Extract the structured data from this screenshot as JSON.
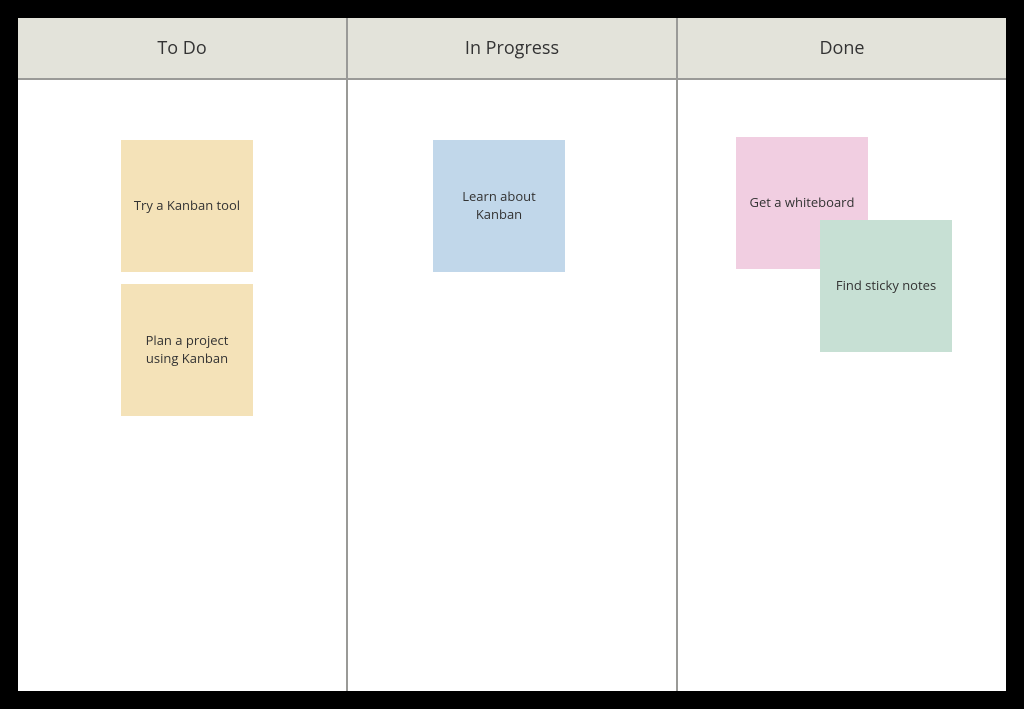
{
  "board": {
    "columns": [
      {
        "title": "To Do"
      },
      {
        "title": "In Progress"
      },
      {
        "title": "Done"
      }
    ],
    "cards": {
      "todo1": "Try a Kanban tool",
      "todo2": "Plan a project using Kanban",
      "progress1": "Learn about Kanban",
      "done1": "Get a whiteboard",
      "done2": "Find sticky notes"
    }
  }
}
